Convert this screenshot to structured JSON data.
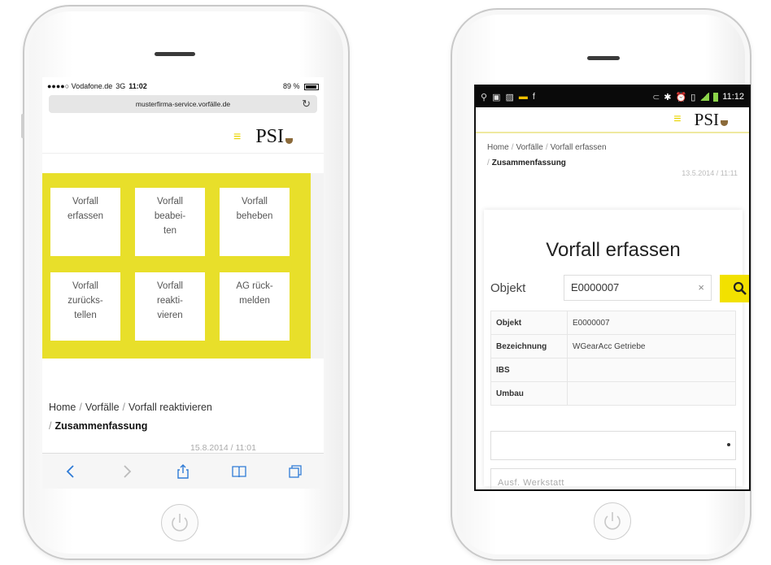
{
  "left_phone": {
    "status": {
      "carrier": "●●●●○ Vodafone.de",
      "network": "3G",
      "time": "11:02",
      "battery": "89 %"
    },
    "url": "musterfirma-service.vorfälle.de",
    "hamburger": "≡",
    "logo": "PSI",
    "tiles": [
      {
        "label": "Vorfall\nerfassen"
      },
      {
        "label": "Vorfall\nbeabei-\nten"
      },
      {
        "label": "Vorfall\nbeheben"
      },
      {
        "label": "Vorfall\nzurücks-\ntellen"
      },
      {
        "label": "Vorfall\nreakti-\nvieren"
      },
      {
        "label": "AG rück-\nmelden"
      }
    ],
    "breadcrumb": {
      "home": "Home",
      "sep": "/",
      "level1": "Vorfälle",
      "level2": "Vorfall reaktivieren",
      "current": "Zusammenfassung"
    },
    "date": "15.8.2014 / 11:01"
  },
  "right_phone": {
    "status": {
      "time": "11:12"
    },
    "hamburger": "≡",
    "logo": "PSI",
    "breadcrumb": {
      "home": "Home",
      "sep": "/",
      "level1": "Vorfälle",
      "level2": "Vorfall erfassen",
      "current": "Zusammenfassung"
    },
    "date": "13.5.2014 / 11:11",
    "form": {
      "title": "Vorfall erfassen",
      "field_label": "Objekt",
      "field_value": "E0000007",
      "clear": "×",
      "table": [
        {
          "key": "Objekt",
          "value": "E0000007"
        },
        {
          "key": "Bezeichnung",
          "value": "WGearAcc Getriebe"
        },
        {
          "key": "IBS",
          "value": ""
        },
        {
          "key": "Umbau",
          "value": ""
        }
      ],
      "text_placeholder": "Ausf. Werkstatt"
    }
  },
  "colors": {
    "accent_yellow": "#e8df2a",
    "search_yellow": "#f2e100",
    "logo_brown": "#8b6a3a"
  }
}
